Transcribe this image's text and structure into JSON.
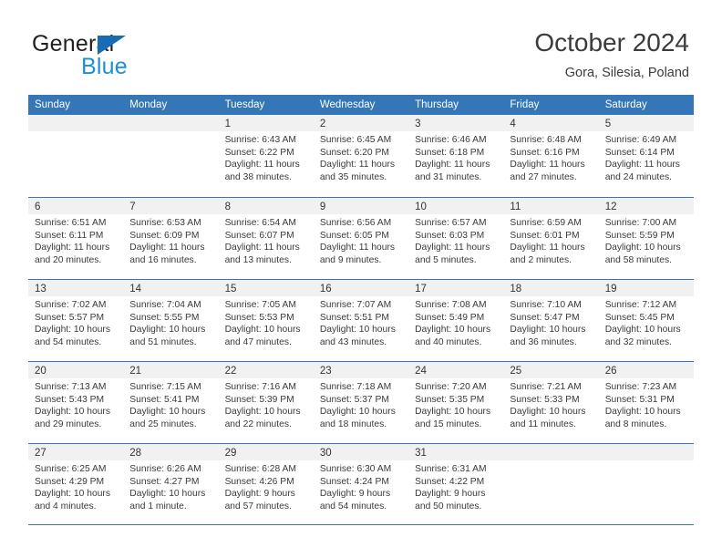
{
  "logo": {
    "word_one": "General",
    "word_two": "Blue",
    "triangle_color": "#1a6bb5",
    "blue_color": "#1a8fe0"
  },
  "header": {
    "title": "October 2024",
    "subtitle": "Gora, Silesia, Poland"
  },
  "theme": {
    "header_blue": "#3576b6",
    "day_band_gray": "#f1f1f1",
    "text_color": "#3a3a3a"
  },
  "calendar": {
    "day_headers": [
      "Sunday",
      "Monday",
      "Tuesday",
      "Wednesday",
      "Thursday",
      "Friday",
      "Saturday"
    ],
    "weeks": [
      [
        {
          "day": "",
          "sunrise": "",
          "sunset": "",
          "daylight_1": "",
          "daylight_2": ""
        },
        {
          "day": "",
          "sunrise": "",
          "sunset": "",
          "daylight_1": "",
          "daylight_2": ""
        },
        {
          "day": "1",
          "sunrise": "Sunrise: 6:43 AM",
          "sunset": "Sunset: 6:22 PM",
          "daylight_1": "Daylight: 11 hours",
          "daylight_2": "and 38 minutes."
        },
        {
          "day": "2",
          "sunrise": "Sunrise: 6:45 AM",
          "sunset": "Sunset: 6:20 PM",
          "daylight_1": "Daylight: 11 hours",
          "daylight_2": "and 35 minutes."
        },
        {
          "day": "3",
          "sunrise": "Sunrise: 6:46 AM",
          "sunset": "Sunset: 6:18 PM",
          "daylight_1": "Daylight: 11 hours",
          "daylight_2": "and 31 minutes."
        },
        {
          "day": "4",
          "sunrise": "Sunrise: 6:48 AM",
          "sunset": "Sunset: 6:16 PM",
          "daylight_1": "Daylight: 11 hours",
          "daylight_2": "and 27 minutes."
        },
        {
          "day": "5",
          "sunrise": "Sunrise: 6:49 AM",
          "sunset": "Sunset: 6:14 PM",
          "daylight_1": "Daylight: 11 hours",
          "daylight_2": "and 24 minutes."
        }
      ],
      [
        {
          "day": "6",
          "sunrise": "Sunrise: 6:51 AM",
          "sunset": "Sunset: 6:11 PM",
          "daylight_1": "Daylight: 11 hours",
          "daylight_2": "and 20 minutes."
        },
        {
          "day": "7",
          "sunrise": "Sunrise: 6:53 AM",
          "sunset": "Sunset: 6:09 PM",
          "daylight_1": "Daylight: 11 hours",
          "daylight_2": "and 16 minutes."
        },
        {
          "day": "8",
          "sunrise": "Sunrise: 6:54 AM",
          "sunset": "Sunset: 6:07 PM",
          "daylight_1": "Daylight: 11 hours",
          "daylight_2": "and 13 minutes."
        },
        {
          "day": "9",
          "sunrise": "Sunrise: 6:56 AM",
          "sunset": "Sunset: 6:05 PM",
          "daylight_1": "Daylight: 11 hours",
          "daylight_2": "and 9 minutes."
        },
        {
          "day": "10",
          "sunrise": "Sunrise: 6:57 AM",
          "sunset": "Sunset: 6:03 PM",
          "daylight_1": "Daylight: 11 hours",
          "daylight_2": "and 5 minutes."
        },
        {
          "day": "11",
          "sunrise": "Sunrise: 6:59 AM",
          "sunset": "Sunset: 6:01 PM",
          "daylight_1": "Daylight: 11 hours",
          "daylight_2": "and 2 minutes."
        },
        {
          "day": "12",
          "sunrise": "Sunrise: 7:00 AM",
          "sunset": "Sunset: 5:59 PM",
          "daylight_1": "Daylight: 10 hours",
          "daylight_2": "and 58 minutes."
        }
      ],
      [
        {
          "day": "13",
          "sunrise": "Sunrise: 7:02 AM",
          "sunset": "Sunset: 5:57 PM",
          "daylight_1": "Daylight: 10 hours",
          "daylight_2": "and 54 minutes."
        },
        {
          "day": "14",
          "sunrise": "Sunrise: 7:04 AM",
          "sunset": "Sunset: 5:55 PM",
          "daylight_1": "Daylight: 10 hours",
          "daylight_2": "and 51 minutes."
        },
        {
          "day": "15",
          "sunrise": "Sunrise: 7:05 AM",
          "sunset": "Sunset: 5:53 PM",
          "daylight_1": "Daylight: 10 hours",
          "daylight_2": "and 47 minutes."
        },
        {
          "day": "16",
          "sunrise": "Sunrise: 7:07 AM",
          "sunset": "Sunset: 5:51 PM",
          "daylight_1": "Daylight: 10 hours",
          "daylight_2": "and 43 minutes."
        },
        {
          "day": "17",
          "sunrise": "Sunrise: 7:08 AM",
          "sunset": "Sunset: 5:49 PM",
          "daylight_1": "Daylight: 10 hours",
          "daylight_2": "and 40 minutes."
        },
        {
          "day": "18",
          "sunrise": "Sunrise: 7:10 AM",
          "sunset": "Sunset: 5:47 PM",
          "daylight_1": "Daylight: 10 hours",
          "daylight_2": "and 36 minutes."
        },
        {
          "day": "19",
          "sunrise": "Sunrise: 7:12 AM",
          "sunset": "Sunset: 5:45 PM",
          "daylight_1": "Daylight: 10 hours",
          "daylight_2": "and 32 minutes."
        }
      ],
      [
        {
          "day": "20",
          "sunrise": "Sunrise: 7:13 AM",
          "sunset": "Sunset: 5:43 PM",
          "daylight_1": "Daylight: 10 hours",
          "daylight_2": "and 29 minutes."
        },
        {
          "day": "21",
          "sunrise": "Sunrise: 7:15 AM",
          "sunset": "Sunset: 5:41 PM",
          "daylight_1": "Daylight: 10 hours",
          "daylight_2": "and 25 minutes."
        },
        {
          "day": "22",
          "sunrise": "Sunrise: 7:16 AM",
          "sunset": "Sunset: 5:39 PM",
          "daylight_1": "Daylight: 10 hours",
          "daylight_2": "and 22 minutes."
        },
        {
          "day": "23",
          "sunrise": "Sunrise: 7:18 AM",
          "sunset": "Sunset: 5:37 PM",
          "daylight_1": "Daylight: 10 hours",
          "daylight_2": "and 18 minutes."
        },
        {
          "day": "24",
          "sunrise": "Sunrise: 7:20 AM",
          "sunset": "Sunset: 5:35 PM",
          "daylight_1": "Daylight: 10 hours",
          "daylight_2": "and 15 minutes."
        },
        {
          "day": "25",
          "sunrise": "Sunrise: 7:21 AM",
          "sunset": "Sunset: 5:33 PM",
          "daylight_1": "Daylight: 10 hours",
          "daylight_2": "and 11 minutes."
        },
        {
          "day": "26",
          "sunrise": "Sunrise: 7:23 AM",
          "sunset": "Sunset: 5:31 PM",
          "daylight_1": "Daylight: 10 hours",
          "daylight_2": "and 8 minutes."
        }
      ],
      [
        {
          "day": "27",
          "sunrise": "Sunrise: 6:25 AM",
          "sunset": "Sunset: 4:29 PM",
          "daylight_1": "Daylight: 10 hours",
          "daylight_2": "and 4 minutes."
        },
        {
          "day": "28",
          "sunrise": "Sunrise: 6:26 AM",
          "sunset": "Sunset: 4:27 PM",
          "daylight_1": "Daylight: 10 hours",
          "daylight_2": "and 1 minute."
        },
        {
          "day": "29",
          "sunrise": "Sunrise: 6:28 AM",
          "sunset": "Sunset: 4:26 PM",
          "daylight_1": "Daylight: 9 hours",
          "daylight_2": "and 57 minutes."
        },
        {
          "day": "30",
          "sunrise": "Sunrise: 6:30 AM",
          "sunset": "Sunset: 4:24 PM",
          "daylight_1": "Daylight: 9 hours",
          "daylight_2": "and 54 minutes."
        },
        {
          "day": "31",
          "sunrise": "Sunrise: 6:31 AM",
          "sunset": "Sunset: 4:22 PM",
          "daylight_1": "Daylight: 9 hours",
          "daylight_2": "and 50 minutes."
        },
        {
          "day": "",
          "sunrise": "",
          "sunset": "",
          "daylight_1": "",
          "daylight_2": ""
        },
        {
          "day": "",
          "sunrise": "",
          "sunset": "",
          "daylight_1": "",
          "daylight_2": ""
        }
      ]
    ]
  }
}
